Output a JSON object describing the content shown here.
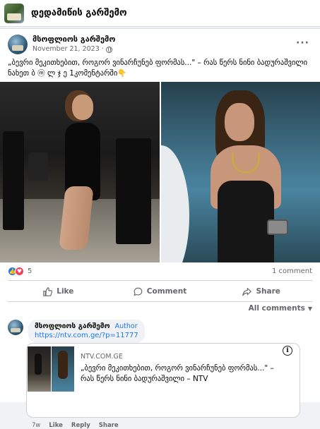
{
  "group": {
    "title": "დედამიწის გარშემო"
  },
  "post": {
    "author": "მსოფლიოს გარშემო",
    "time": "November 21, 2023 ·",
    "text_line1": "„ბევრი მეკითხებით, როგორ ვინარჩუნებ ფორმას...\" – რას წერს ნინი ბადურაშვილი",
    "text_line2": "ნახეთ ბ ⓜ ლ ჯ ე   1კომენტარში👇",
    "more_icon": "more-dots-icon",
    "privacy_icon": "globe-icon",
    "reaction_count": "5",
    "comment_count": "1 comment",
    "actions": {
      "like": "Like",
      "comment": "Comment",
      "share": "Share"
    },
    "all_comments": "All comments"
  },
  "comment": {
    "author": "მსოფლიოს გარშემო",
    "badge": "Author",
    "link": "https://ntv.com.ge/?p=11777",
    "preview_domain": "NTV.COM.GE",
    "preview_title_line1": "„ბევრი მეკითხებით, როგორ ვინარჩუნებ ფორმას...\" –",
    "preview_title_line2": "რას წერს ნინი ბადურაშვილი – NTV",
    "age": "7w",
    "like": "Like",
    "reply": "Reply",
    "share": "Share"
  },
  "colors": {
    "accent": "#1877f2",
    "love": "#f33e58",
    "muted": "#65676b"
  }
}
